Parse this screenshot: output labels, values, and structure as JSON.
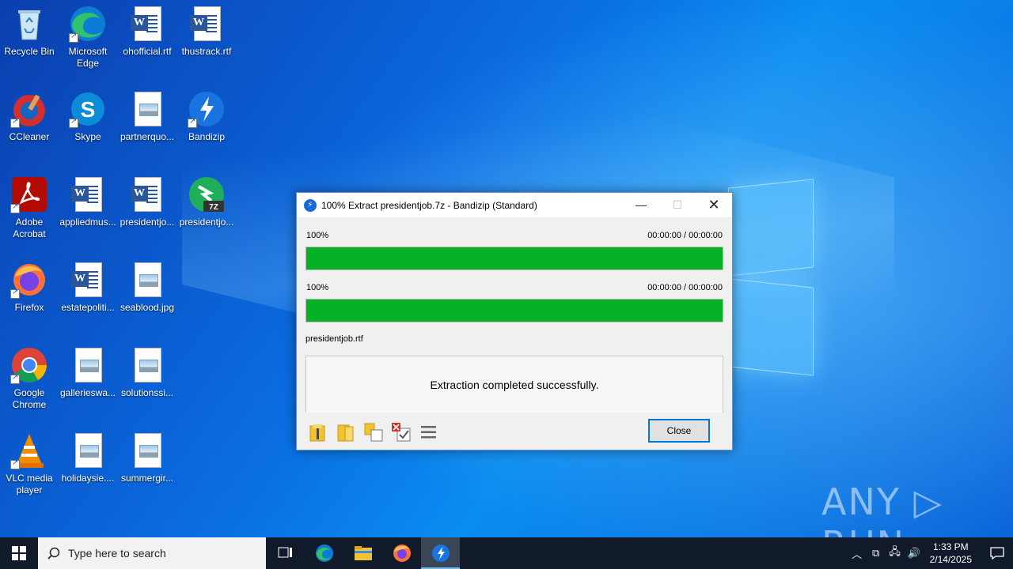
{
  "desktop_icons": [
    {
      "label": "Recycle Bin",
      "icon": "recycle-bin-icon"
    },
    {
      "label": "Microsoft Edge",
      "icon": "edge-icon"
    },
    {
      "label": "ohofficial.rtf",
      "icon": "word-doc-icon"
    },
    {
      "label": "thustrack.rtf",
      "icon": "word-doc-icon"
    },
    {
      "label": "CCleaner",
      "icon": "ccleaner-icon"
    },
    {
      "label": "Skype",
      "icon": "skype-icon"
    },
    {
      "label": "partnerquo...",
      "icon": "image-file-icon"
    },
    {
      "label": "Bandizip",
      "icon": "bandizip-icon"
    },
    {
      "label": "Adobe Acrobat",
      "icon": "acrobat-icon"
    },
    {
      "label": "appliedmus...",
      "icon": "word-doc-icon"
    },
    {
      "label": "presidentjo...",
      "icon": "word-doc-icon"
    },
    {
      "label": "presidentjo...",
      "icon": "7z-archive-icon"
    },
    {
      "label": "Firefox",
      "icon": "firefox-icon"
    },
    {
      "label": "estatepoliti...",
      "icon": "word-doc-icon"
    },
    {
      "label": "seablood.jpg",
      "icon": "image-file-icon"
    },
    {
      "label": "Google Chrome",
      "icon": "chrome-icon"
    },
    {
      "label": "gallerieswa...",
      "icon": "image-file-icon"
    },
    {
      "label": "solutionssi...",
      "icon": "image-file-icon"
    },
    {
      "label": "VLC media player",
      "icon": "vlc-icon"
    },
    {
      "label": "holidaysie....",
      "icon": "image-file-icon"
    },
    {
      "label": "summergir...",
      "icon": "image-file-icon"
    }
  ],
  "dialog": {
    "title": "100% Extract presidentjob.7z - Bandizip (Standard)",
    "progress1": {
      "percent_label": "100%",
      "time": "00:00:00 / 00:00:00",
      "value": 100
    },
    "progress2": {
      "percent_label": "100%",
      "time": "00:00:00 / 00:00:00",
      "value": 100
    },
    "current_file": "presidentjob.rtf",
    "message": "Extraction completed successfully.",
    "close_label": "Close"
  },
  "watermark": "ANY ▷ RUN",
  "taskbar": {
    "search_placeholder": "Type here to search",
    "time": "1:33 PM",
    "date": "2/14/2025"
  },
  "colors": {
    "progress_fill": "#06b025",
    "taskbar": "#101a2a",
    "accent": "#0078d7"
  }
}
